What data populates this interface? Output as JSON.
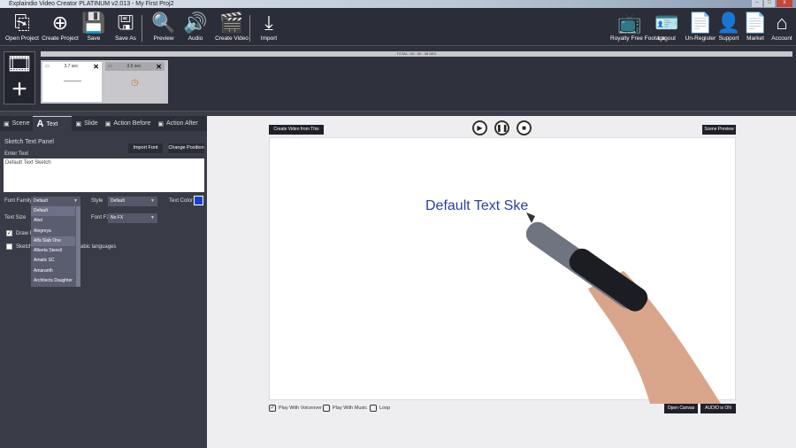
{
  "window": {
    "title": "Explaindio Video Creator PLATINUM v2.013 - My First Proj2"
  },
  "toolbar": {
    "left": [
      {
        "label": "Open Project",
        "icon": "open-project-icon",
        "glyph": "⎘"
      },
      {
        "label": "Create Project",
        "icon": "create-project-icon",
        "glyph": "⊕"
      },
      {
        "label": "Save",
        "icon": "save-icon",
        "glyph": "💾"
      },
      {
        "label": "Save As",
        "icon": "save-as-icon",
        "glyph": "🖫"
      },
      {
        "label": "Preview",
        "icon": "search-icon",
        "glyph": "🔍"
      },
      {
        "label": "Audio",
        "icon": "speaker-icon",
        "glyph": "🔊"
      },
      {
        "label": "Create Video",
        "icon": "clapperboard-icon",
        "glyph": "🎬"
      },
      {
        "label": "Import",
        "icon": "download-icon",
        "glyph": "⤓"
      }
    ],
    "right": [
      {
        "label": "Royalty Free Footage",
        "icon": "tv-icon",
        "glyph": "📺"
      },
      {
        "label": "Logout",
        "icon": "id-card-icon",
        "glyph": "🪪"
      },
      {
        "label": "Un-Register",
        "icon": "certificate-icon",
        "glyph": "📄"
      },
      {
        "label": "Support",
        "icon": "user-icon",
        "glyph": "👤"
      },
      {
        "label": "Market",
        "icon": "certificate-icon",
        "glyph": "📄"
      },
      {
        "label": "Account",
        "icon": "home-icon",
        "glyph": "⌂"
      }
    ]
  },
  "timeline": {
    "total": "TOTAL : 00 : 00 : 06 SEC",
    "scenes": [
      {
        "duration": "3.7 sec"
      },
      {
        "duration": "3.6 sec"
      }
    ]
  },
  "tabs": [
    {
      "label": "Scene"
    },
    {
      "label": "Text"
    },
    {
      "label": "Slide"
    },
    {
      "label": "Action Before"
    },
    {
      "label": "Action After"
    }
  ],
  "panel": {
    "title": "Sketch Text Panel",
    "import_font": "Import Font",
    "change_position": "Change Position",
    "enter_text_label": "Enter Text",
    "text_value": "Default Text Sketch",
    "font_family_label": "Font Family",
    "font_family_value": "Default",
    "style_label": "Style",
    "style_value": "Default",
    "text_color_label": "Text Color",
    "text_color": "#1a3fd0",
    "text_size_label": "Text Size",
    "font_fx_label": "Font FX",
    "font_fx_value": "No FX",
    "draw_label": "Draw F",
    "sketch_label": "Sketch",
    "arabic_label": "abic languages",
    "font_options": [
      "Default",
      "Abel",
      "Alegreya",
      "Alfa Slab One",
      "Alberta Stencil",
      "Amatic SC",
      "Amaranth",
      "Architects Daughter"
    ]
  },
  "preview": {
    "create_video_scene": "Create Video from This Scene",
    "scene_preview": "Scene Preview",
    "canvas_text": "Default Text Ske",
    "play_voiceover": "Play With Voiceover",
    "play_music": "Play With Music",
    "loop": "Loop",
    "open_canvas": "Open Canvas",
    "audio_status": "AUDIO is ON"
  }
}
